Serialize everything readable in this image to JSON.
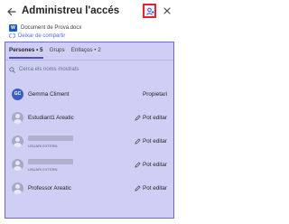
{
  "header": {
    "title": "Administreu l'accés",
    "back_icon": "back-arrow-icon",
    "share_icon": "share-people-icon",
    "close_icon": "close-icon"
  },
  "document": {
    "icon": "word-document-icon",
    "icon_letter": "W",
    "name": "Document de Prova.docx"
  },
  "stop_sharing": {
    "icon": "unlink-icon",
    "label": "Deixar de compartir"
  },
  "tabs": [
    {
      "label": "Persones • 5",
      "active": true
    },
    {
      "label": "Grups",
      "active": false
    },
    {
      "label": "Enllaços • 2",
      "active": false
    }
  ],
  "search": {
    "icon": "search-icon",
    "placeholder": "Cerca els noms mostrats"
  },
  "people": [
    {
      "avatar_initials": "GC",
      "name": "Gemma Climent",
      "permission": "Propietari"
    },
    {
      "name": "Estudiant1 Areatic",
      "permission": "Pot editar"
    },
    {
      "name": "",
      "subtitle": "USUARI EXTERN",
      "permission": "Pot editar"
    },
    {
      "name": "",
      "subtitle": "USUARI EXTERN",
      "permission": "Pot editar"
    },
    {
      "name": "Professor Areatic",
      "permission": "Pot editar"
    }
  ],
  "colors": {
    "accent": "#4f52b2",
    "highlight_border": "#e0252c",
    "panel_bg": "#cfcff5",
    "word_blue": "#185abd"
  }
}
